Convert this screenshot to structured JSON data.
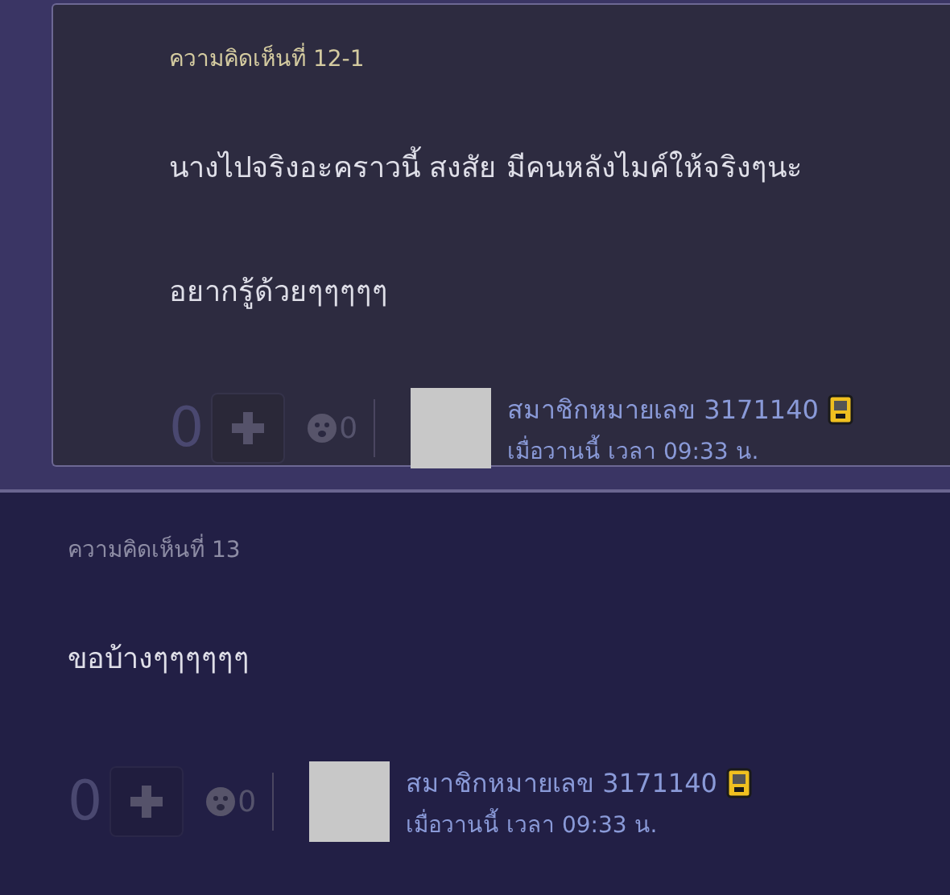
{
  "comments": [
    {
      "kind": "reply",
      "header": "ความคิดเห็นที่ 12-1",
      "paragraphs": [
        "นางไปจริงอะคราวนี้ สงสัย มีคนหลังไมค์ให้จริงๆนะ",
        "อยากรู้ด้วยๆๆๆๆๆ"
      ],
      "votes": "0",
      "emotions": "0",
      "member": "สมาชิกหมายเลข 3171140",
      "time": "เมื่อวานนี้ เวลา 09:33 น."
    },
    {
      "kind": "comment",
      "header": "ความคิดเห็นที่ 13",
      "paragraphs": [
        "ขอบ้างๆๆๆๆๆๆ"
      ],
      "votes": "0",
      "emotions": "0",
      "member": "สมาชิกหมายเลข 3171140",
      "time": "เมื่อวานนี้ เวลา 09:33 น."
    }
  ]
}
